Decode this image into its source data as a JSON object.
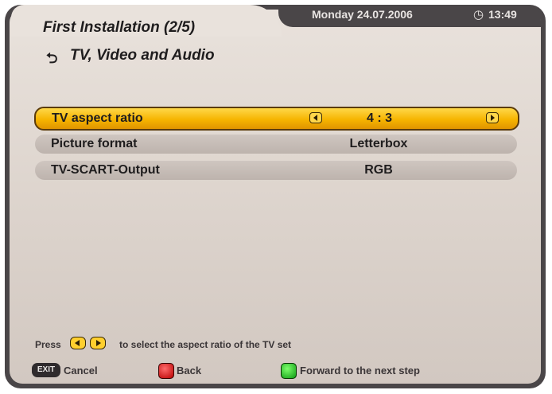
{
  "header": {
    "title": "First Installation (2/5)",
    "subtitle": "TV, Video and Audio",
    "subtitle_icon": "return-arrow-icon",
    "date": "Monday 24.07.2006",
    "time": "13:49",
    "clock_icon": "clock-icon"
  },
  "settings": [
    {
      "label": "TV aspect ratio",
      "value": "4 : 3",
      "selected": true
    },
    {
      "label": "Picture format",
      "value": "Letterbox",
      "selected": false
    },
    {
      "label": "TV-SCART-Output",
      "value": "RGB",
      "selected": false
    }
  ],
  "hint": {
    "prefix": "Press",
    "text": "to select the aspect ratio of the TV set"
  },
  "footer": {
    "exit_key": "EXIT",
    "cancel_label": "Cancel",
    "back_label": "Back",
    "forward_label": "Forward to the next step"
  },
  "colors": {
    "selected_row": "#f6b400",
    "row": "#c6bcb6",
    "frame": "#4a4648",
    "red_key": "#d10000",
    "green_key": "#14b81a"
  }
}
